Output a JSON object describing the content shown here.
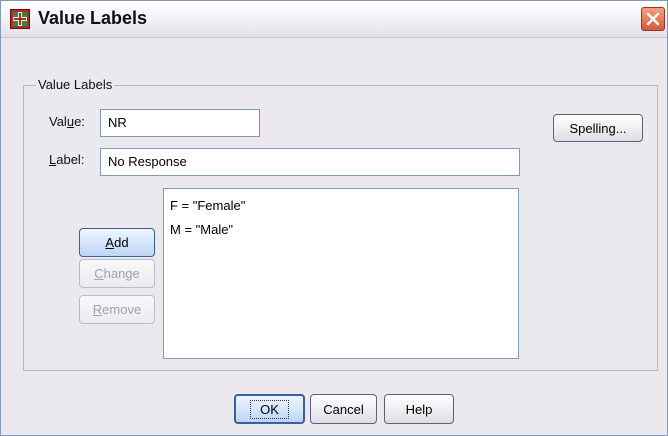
{
  "window": {
    "title": "Value Labels",
    "icons": {
      "app": "value-labels-grid-icon",
      "close": "close-x-icon"
    },
    "colors": {
      "frame": "#ebe9ed",
      "close_button": "#d45a37",
      "field_border": "#7f9db9"
    }
  },
  "group": {
    "legend": "Value Labels"
  },
  "fields": {
    "value": {
      "label_pre": "Val",
      "label_mn": "u",
      "label_post": "e:",
      "value": "NR"
    },
    "label": {
      "label_mn": "L",
      "label_post": "abel:",
      "value": "No Response"
    }
  },
  "spelling_button": "Spelling...",
  "side_buttons": {
    "add": {
      "mn": "A",
      "rest": "dd"
    },
    "change": {
      "mn": "C",
      "rest": "hange"
    },
    "remove": {
      "mn": "R",
      "rest": "emove"
    }
  },
  "list": {
    "items": [
      "F = \"Female\"",
      "M = \"Male\""
    ]
  },
  "footer": {
    "ok": "OK",
    "cancel": "Cancel",
    "help": "Help"
  }
}
